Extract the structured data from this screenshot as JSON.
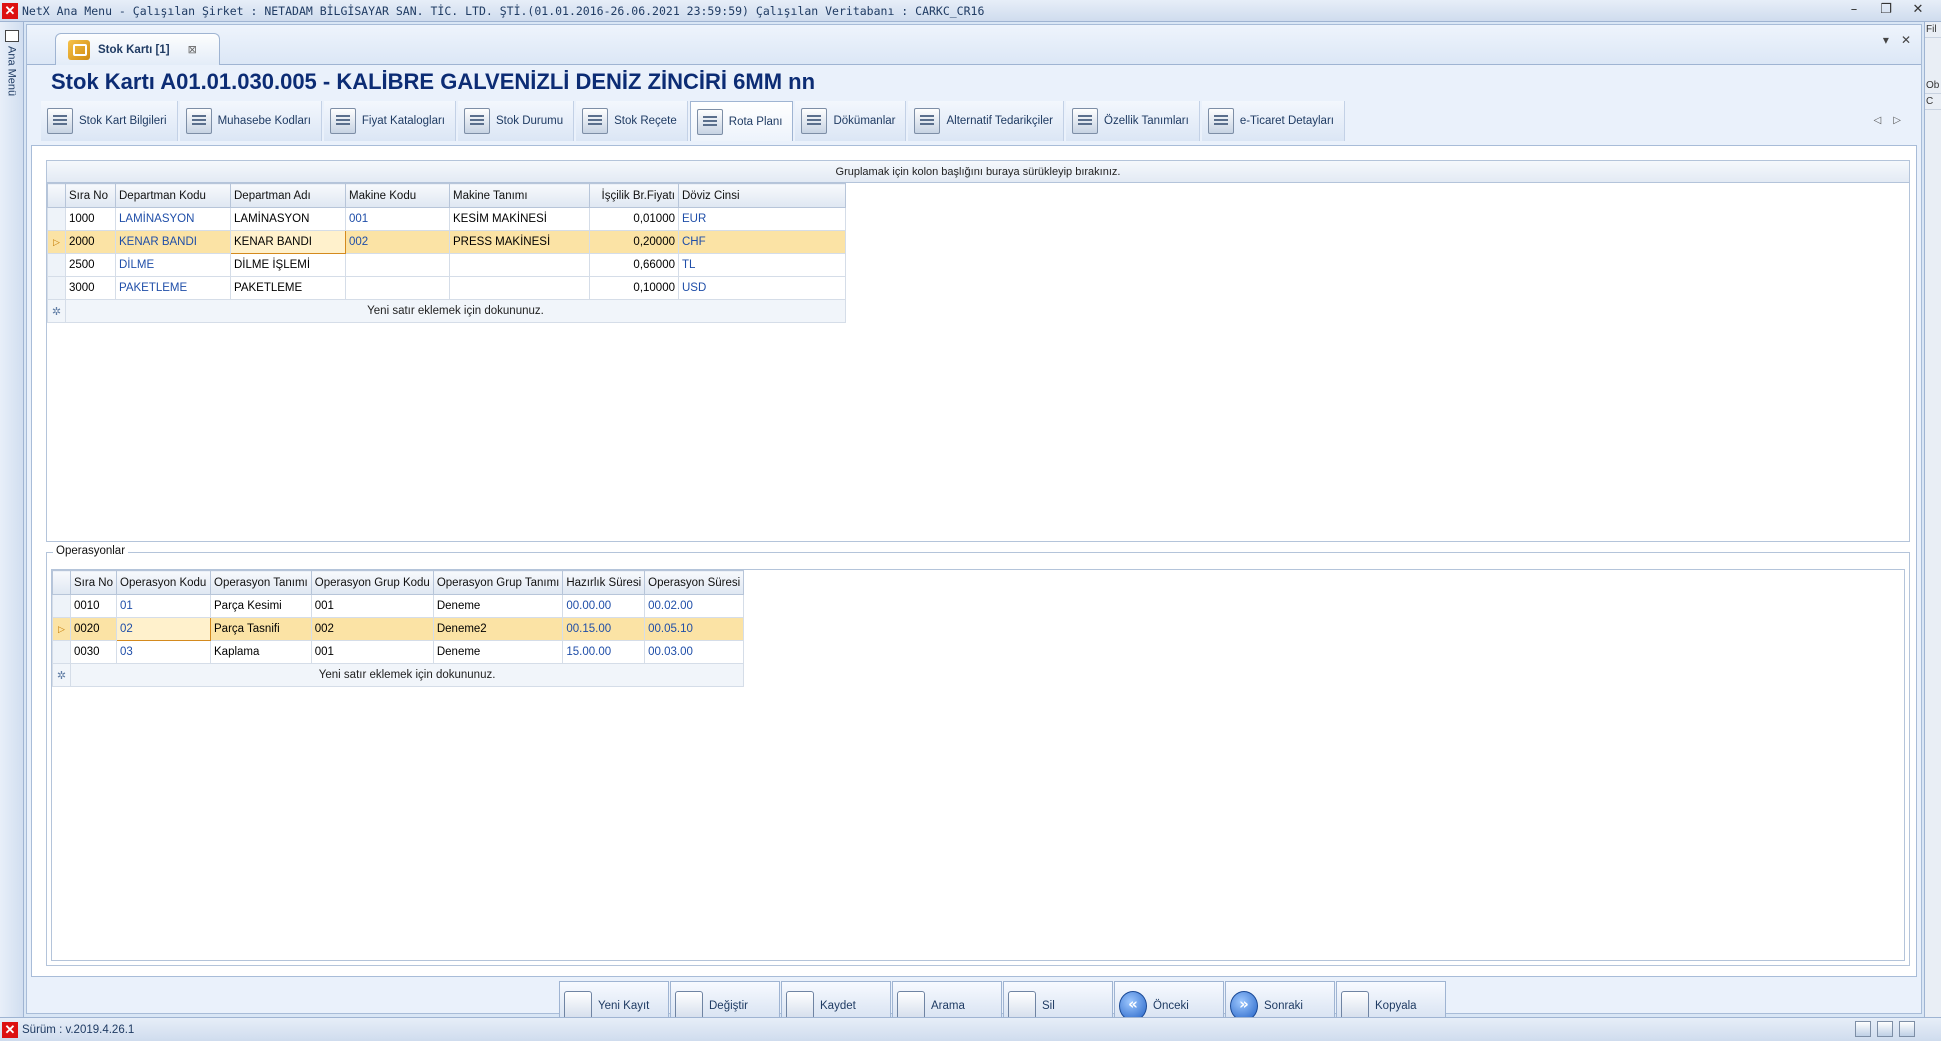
{
  "window": {
    "title": "NetX Ana Menu - Çalışılan Şirket : NETADAM BİLGİSAYAR SAN. TİC. LTD. ŞTİ.(01.01.2016-26.06.2021 23:59:59) Çalışılan Veritabanı : CARKC_CR16",
    "controls": {
      "minimize": "–",
      "restore": "❐",
      "close": "✕"
    }
  },
  "left_panel": {
    "label": "Ana Menü"
  },
  "right_strip": {
    "items": [
      "Ob",
      "C",
      "Fil"
    ]
  },
  "doc_tab": {
    "label": "Stok Kartı [1]",
    "close": "⊠"
  },
  "doc_controls": {
    "dropdown": "▾",
    "close": "✕"
  },
  "heading": "Stok Kartı  A01.01.030.005 - KALİBRE GALVENİZLİ DENİZ ZİNCİRİ  6MM nn",
  "ribbon": {
    "tabs": [
      {
        "label": "Stok Kart Bilgileri",
        "icon": "card-icon"
      },
      {
        "label": "Muhasebe Kodları",
        "icon": "ledger-icon"
      },
      {
        "label": "Fiyat Katalogları",
        "icon": "catalog-icon"
      },
      {
        "label": "Stok Durumu",
        "icon": "stock-icon"
      },
      {
        "label": "Stok Reçete",
        "icon": "recipe-icon"
      },
      {
        "label": "Rota Planı",
        "icon": "route-icon"
      },
      {
        "label": "Dökümanlar",
        "icon": "document-icon"
      },
      {
        "label": "Alternatif Tedarikçiler",
        "icon": "supplier-icon"
      },
      {
        "label": "Özellik Tanımları",
        "icon": "property-icon"
      },
      {
        "label": "e-Ticaret Detayları",
        "icon": "ecommerce-icon"
      }
    ],
    "active_index": 5,
    "nav_prev": "◁",
    "nav_next": "▷"
  },
  "route_grid": {
    "group_hint": "Gruplamak için kolon başlığını buraya sürükleyip bırakınız.",
    "columns": [
      "Sıra No",
      "Departman Kodu",
      "Departman Adı",
      "Makine Kodu",
      "Makine Tanımı",
      "İşçilik Br.Fiyatı",
      "Döviz Cinsi"
    ],
    "rows": [
      [
        "1000",
        "LAMİNASYON",
        "LAMİNASYON",
        "001",
        "KESİM MAKİNESİ",
        "0,01000",
        "EUR"
      ],
      [
        "2000",
        "KENAR BANDI",
        "KENAR BANDI",
        "002",
        "PRESS MAKİNESİ",
        "0,20000",
        "CHF"
      ],
      [
        "2500",
        "DİLME",
        "DİLME İŞLEMİ",
        "",
        "",
        "0,66000",
        "TL"
      ],
      [
        "3000",
        "PAKETLEME",
        "PAKETLEME",
        "",
        "",
        "0,10000",
        "USD"
      ]
    ],
    "selected_row": 1,
    "new_row_text": "Yeni satır eklemek için dokununuz."
  },
  "operations": {
    "group_label": "Operasyonlar",
    "columns": [
      "Sıra No",
      "Operasyon Kodu",
      "Operasyon Tanımı",
      "Operasyon Grup Kodu",
      "Operasyon Grup Tanımı",
      "Hazırlık Süresi",
      "Operasyon Süresi"
    ],
    "rows": [
      [
        "0010",
        "01",
        "Parça Kesimi",
        "001",
        "Deneme",
        "00.00.00",
        "00.02.00"
      ],
      [
        "0020",
        "02",
        "Parça Tasnifi",
        "002",
        "Deneme2",
        "00.15.00",
        "00.05.10"
      ],
      [
        "0030",
        "03",
        "Kaplama",
        "001",
        "Deneme",
        "15.00.00",
        "00.03.00"
      ]
    ],
    "selected_row": 1,
    "new_row_text": "Yeni satır eklemek için dokununuz."
  },
  "actions": [
    {
      "label": "Yeni Kayıt",
      "icon": "new-record-icon"
    },
    {
      "label": "Değiştir",
      "icon": "edit-icon"
    },
    {
      "label": "Kaydet",
      "icon": "save-icon"
    },
    {
      "label": "Arama",
      "icon": "search-icon"
    },
    {
      "label": "Sil",
      "icon": "delete-icon"
    },
    {
      "label": "Önceki",
      "icon": "previous-icon"
    },
    {
      "label": "Sonraki",
      "icon": "next-icon"
    },
    {
      "label": "Kopyala",
      "icon": "copy-icon"
    }
  ],
  "status": {
    "version": "Sürüm : v.2019.4.26.1"
  },
  "colors": {
    "heading": "#0c2c74",
    "selected_row": "#fbe3a5",
    "link_text": "#1f4ea8",
    "app_red": "#dd1111"
  }
}
